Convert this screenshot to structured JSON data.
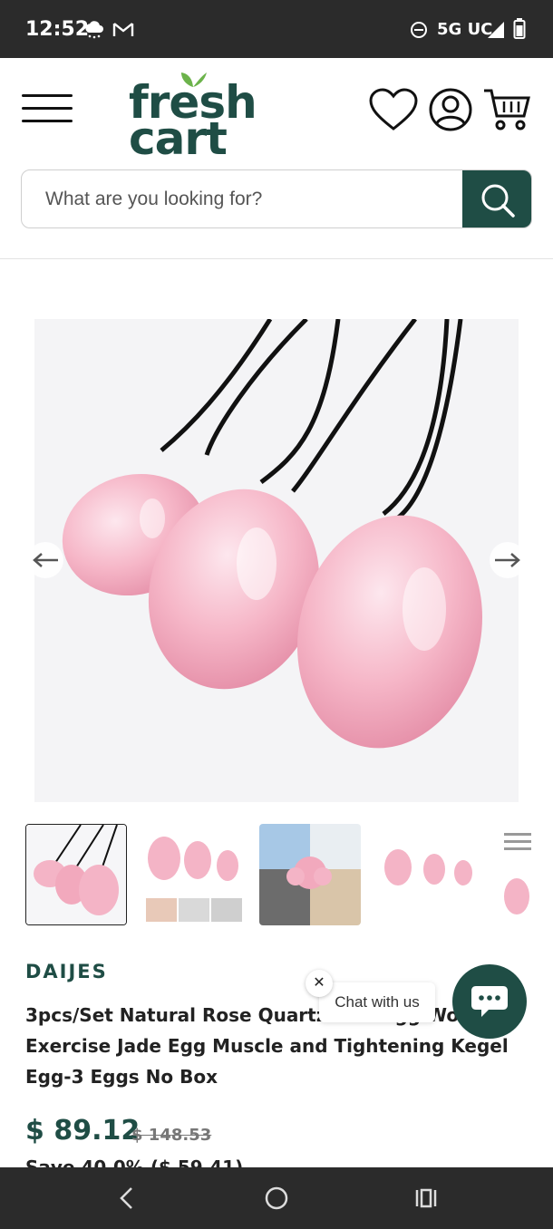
{
  "status_bar": {
    "time": "12:52",
    "network": "5G UC",
    "icons": [
      "cloud-weather-icon",
      "gmail-icon",
      "do-not-disturb-icon",
      "signal-icon",
      "battery-icon"
    ]
  },
  "header": {
    "logo_line1": "fresh",
    "logo_line2": "cart",
    "icons": [
      "menu-icon",
      "heart-icon",
      "user-icon",
      "cart-icon"
    ],
    "brand_color": "#1f4d45"
  },
  "search": {
    "placeholder": "What are you looking for?"
  },
  "gallery": {
    "thumbnail_count": 5,
    "selected_index": 0,
    "icons": [
      "arrow-left-icon",
      "arrow-right-icon"
    ]
  },
  "product": {
    "brand": "DAIJES",
    "title": "3pcs/Set Natural Rose Quartz Yoni Egg Women Exercise Jade Egg Muscle and Tightening Kegel Egg-3 Eggs No Box",
    "price": "$ 89.12",
    "old_price": "$ 148.53",
    "save_text": "Save 40.0% ($ 59.41)"
  },
  "chat": {
    "close": "✕",
    "label": "Chat with us"
  },
  "nav_bar": {
    "icons": [
      "back-icon",
      "home-icon",
      "recents-icon"
    ]
  }
}
